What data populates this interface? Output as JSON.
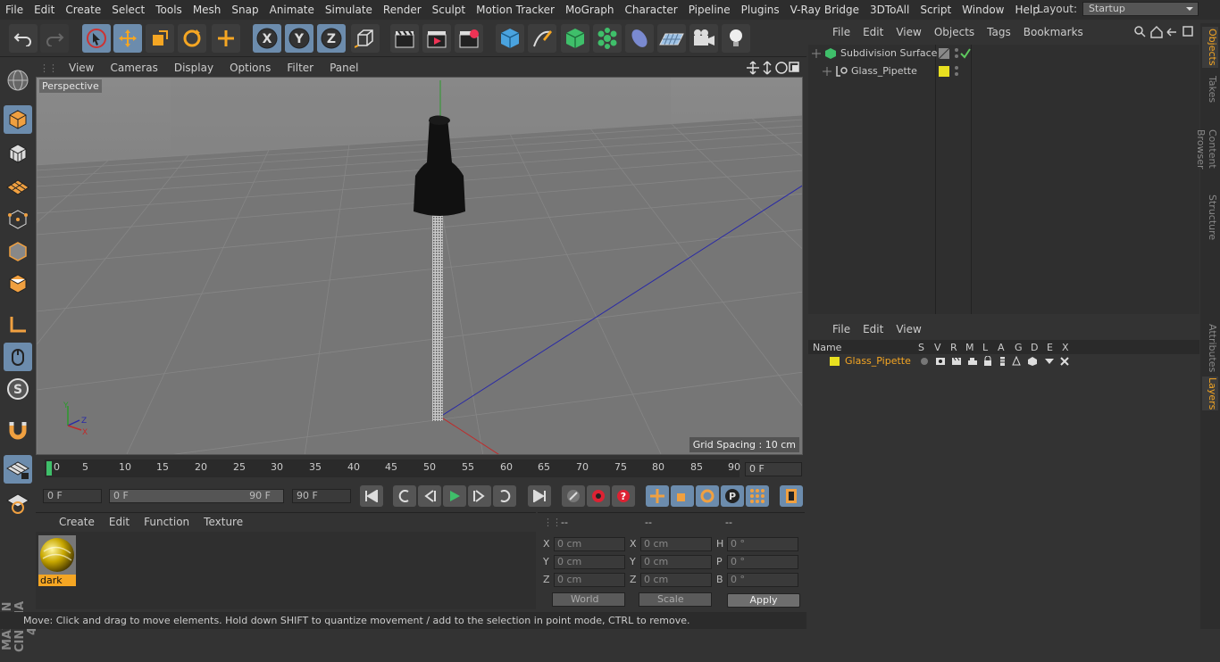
{
  "menubar": {
    "items": [
      "File",
      "Edit",
      "Create",
      "Select",
      "Tools",
      "Mesh",
      "Snap",
      "Animate",
      "Simulate",
      "Render",
      "Sculpt",
      "Motion Tracker",
      "MoGraph",
      "Character",
      "Pipeline",
      "Plugins",
      "V-Ray Bridge",
      "3DToAll",
      "Script",
      "Window",
      "Help"
    ],
    "layout_label": "Layout:",
    "layout_value": "Startup"
  },
  "viewport": {
    "menu": [
      "View",
      "Cameras",
      "Display",
      "Options",
      "Filter",
      "Panel"
    ],
    "label": "Perspective",
    "grid_spacing": "Grid Spacing : 10 cm"
  },
  "timeline": {
    "ticks": [
      "0",
      "5",
      "10",
      "15",
      "20",
      "25",
      "30",
      "35",
      "40",
      "45",
      "50",
      "55",
      "60",
      "65",
      "70",
      "75",
      "80",
      "85",
      "90"
    ],
    "current_frame": "0 F"
  },
  "transport": {
    "start_field": "0 F",
    "range_start": "0 F",
    "range_end": "90 F",
    "end_field": "90 F"
  },
  "materials": {
    "menu": [
      "Create",
      "Edit",
      "Function",
      "Texture"
    ],
    "items": [
      {
        "name": "dark"
      }
    ]
  },
  "coordinates": {
    "headers": [
      "--",
      "--",
      "--"
    ],
    "rows": [
      {
        "pos_label": "X",
        "pos": "0 cm",
        "size_label": "X",
        "size": "0 cm",
        "rot_label": "H",
        "rot": "0 °"
      },
      {
        "pos_label": "Y",
        "pos": "0 cm",
        "size_label": "Y",
        "size": "0 cm",
        "rot_label": "P",
        "rot": "0 °"
      },
      {
        "pos_label": "Z",
        "pos": "0 cm",
        "size_label": "Z",
        "size": "0 cm",
        "rot_label": "B",
        "rot": "0 °"
      }
    ],
    "coord_system": "World",
    "mode": "Scale",
    "apply_label": "Apply"
  },
  "status": {
    "text": "Move: Click and drag to move elements. Hold down SHIFT to quantize movement / add to the selection in point mode, CTRL to remove."
  },
  "objects": {
    "menu": [
      "File",
      "Edit",
      "View",
      "Objects",
      "Tags",
      "Bookmarks"
    ],
    "tree": [
      {
        "name": "Subdivision Surface"
      },
      {
        "name": "Glass_Pipette"
      }
    ]
  },
  "layers": {
    "menu": [
      "File",
      "Edit",
      "View"
    ],
    "columns": [
      "Name",
      "S",
      "V",
      "R",
      "M",
      "L",
      "A",
      "G",
      "D",
      "E",
      "X"
    ],
    "rows": [
      {
        "name": "Glass_Pipette"
      }
    ]
  },
  "right_tabs": [
    "Objects",
    "Takes",
    "Content Browser",
    "Structure",
    "Attributes",
    "Layers"
  ],
  "colors": {
    "accent": "#f5a623",
    "tool_blue": "#6c8cad",
    "layer_yellow": "#e8e020",
    "check_green": "#5ec95e"
  }
}
